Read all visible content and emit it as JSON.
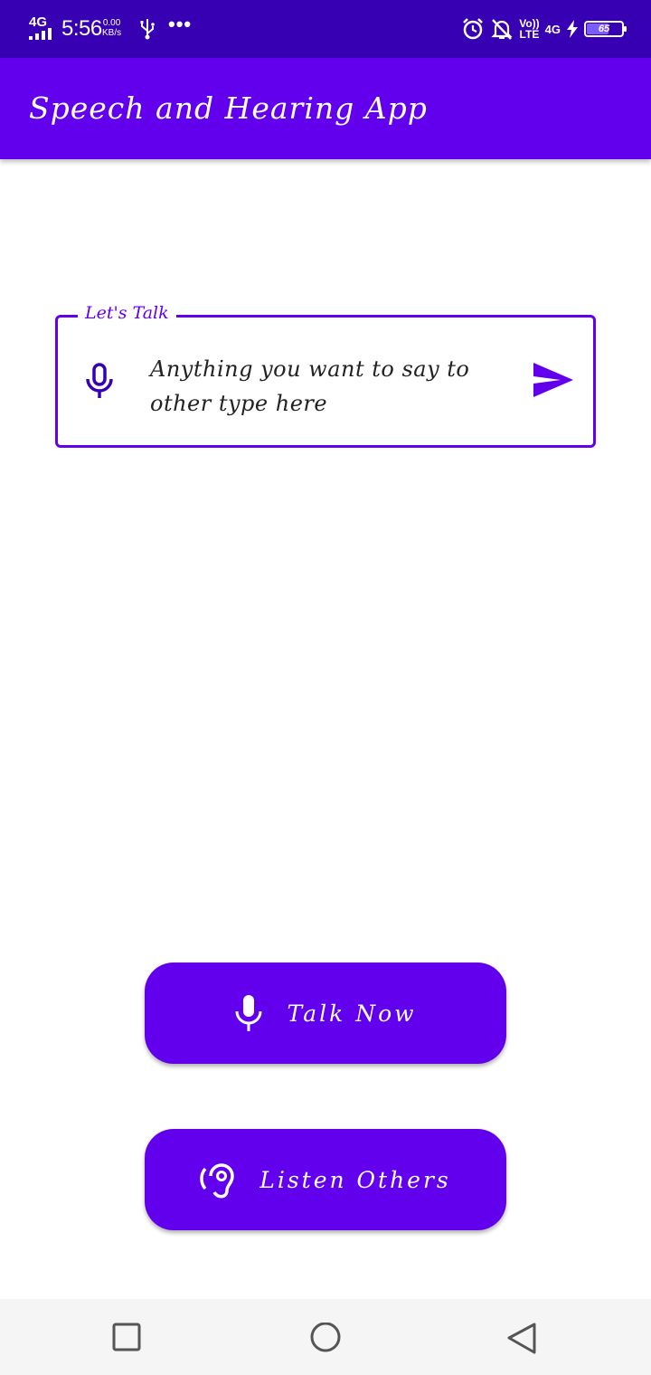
{
  "status_bar": {
    "network": "4G",
    "time": "5:56",
    "speed_value": "0.00",
    "speed_unit": "KB/s",
    "more": "•••",
    "volte": "Vo))",
    "lte": "LTE",
    "network_right": "4G",
    "battery": "65",
    "battery_level": 0.65,
    "icons": [
      "signal-icon",
      "usb-icon",
      "alarm-icon",
      "notifications-off-icon",
      "charging-icon",
      "battery-icon"
    ]
  },
  "app_bar": {
    "title": "Speech and Hearing App"
  },
  "input": {
    "label": "Let's Talk",
    "placeholder": "Anything you want to say to other type here",
    "start_icon": "mic-icon",
    "end_icon": "send-icon"
  },
  "buttons": {
    "talk_label": "Talk Now",
    "talk_icon": "mic-icon",
    "listen_label": "Listen Others",
    "listen_icon": "hearing-icon"
  },
  "nav": {
    "icons": [
      "recents-icon",
      "home-icon",
      "back-icon"
    ]
  },
  "colors": {
    "status_bar": "#3700b3",
    "primary": "#6200ee",
    "background": "#ffffff",
    "nav_bar": "#f5f5f5"
  }
}
